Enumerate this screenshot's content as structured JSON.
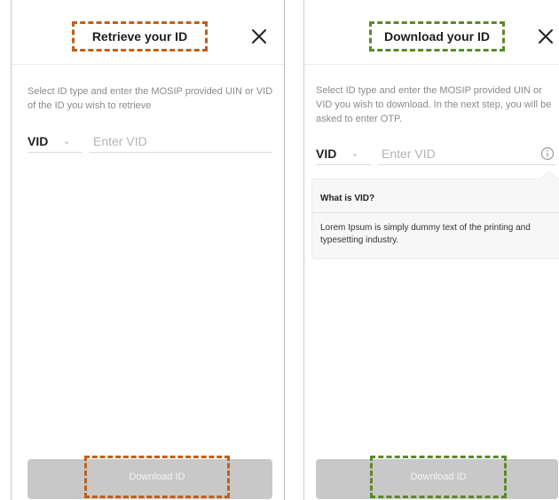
{
  "colors": {
    "left_highlight": "#c0601a",
    "right_highlight": "#5a8a2a",
    "button_disabled": "#c8c8c8"
  },
  "left_panel": {
    "title": "Retrieve your ID",
    "close_icon": "close-icon",
    "instructions": "Select ID type and enter the MOSIP provided UIN or VID of the ID you wish to retrieve",
    "id_type": "VID",
    "input_placeholder": "Enter VID",
    "download_button": "Download ID"
  },
  "right_panel": {
    "title": "Download your ID",
    "close_icon": "close-icon",
    "instructions": "Select ID type and enter the MOSIP provided UIN or VID you wish to download. In the next step, you will be asked to enter OTP.",
    "id_type": "VID",
    "input_placeholder": "Enter VID",
    "info_icon": "info-icon",
    "tooltip": {
      "title": "What is VID?",
      "body": "Lorem Ipsum is simply dummy text of the printing and typesetting industry."
    },
    "download_button": "Download ID"
  }
}
